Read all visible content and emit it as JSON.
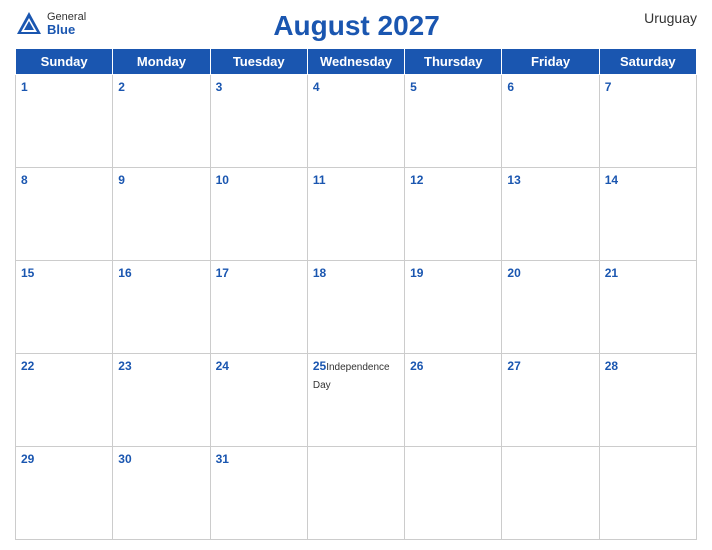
{
  "header": {
    "logo_general": "General",
    "logo_blue": "Blue",
    "title": "August 2027",
    "country": "Uruguay"
  },
  "weekdays": [
    "Sunday",
    "Monday",
    "Tuesday",
    "Wednesday",
    "Thursday",
    "Friday",
    "Saturday"
  ],
  "weeks": [
    [
      {
        "day": "1",
        "event": ""
      },
      {
        "day": "2",
        "event": ""
      },
      {
        "day": "3",
        "event": ""
      },
      {
        "day": "4",
        "event": ""
      },
      {
        "day": "5",
        "event": ""
      },
      {
        "day": "6",
        "event": ""
      },
      {
        "day": "7",
        "event": ""
      }
    ],
    [
      {
        "day": "8",
        "event": ""
      },
      {
        "day": "9",
        "event": ""
      },
      {
        "day": "10",
        "event": ""
      },
      {
        "day": "11",
        "event": ""
      },
      {
        "day": "12",
        "event": ""
      },
      {
        "day": "13",
        "event": ""
      },
      {
        "day": "14",
        "event": ""
      }
    ],
    [
      {
        "day": "15",
        "event": ""
      },
      {
        "day": "16",
        "event": ""
      },
      {
        "day": "17",
        "event": ""
      },
      {
        "day": "18",
        "event": ""
      },
      {
        "day": "19",
        "event": ""
      },
      {
        "day": "20",
        "event": ""
      },
      {
        "day": "21",
        "event": ""
      }
    ],
    [
      {
        "day": "22",
        "event": ""
      },
      {
        "day": "23",
        "event": ""
      },
      {
        "day": "24",
        "event": ""
      },
      {
        "day": "25",
        "event": "Independence Day"
      },
      {
        "day": "26",
        "event": ""
      },
      {
        "day": "27",
        "event": ""
      },
      {
        "day": "28",
        "event": ""
      }
    ],
    [
      {
        "day": "29",
        "event": ""
      },
      {
        "day": "30",
        "event": ""
      },
      {
        "day": "31",
        "event": ""
      },
      {
        "day": "",
        "event": ""
      },
      {
        "day": "",
        "event": ""
      },
      {
        "day": "",
        "event": ""
      },
      {
        "day": "",
        "event": ""
      }
    ]
  ],
  "sunday_col": [
    0,
    0,
    0,
    0,
    0
  ],
  "blue_accent": "#1a56b0"
}
